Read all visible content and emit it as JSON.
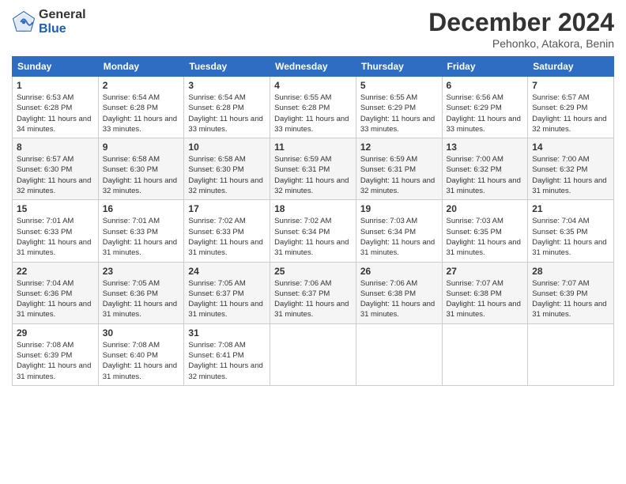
{
  "header": {
    "logo_general": "General",
    "logo_blue": "Blue",
    "month_year": "December 2024",
    "location": "Pehonko, Atakora, Benin"
  },
  "days_of_week": [
    "Sunday",
    "Monday",
    "Tuesday",
    "Wednesday",
    "Thursday",
    "Friday",
    "Saturday"
  ],
  "weeks": [
    [
      {
        "day": 1,
        "sunrise": "6:53 AM",
        "sunset": "6:28 PM",
        "daylight": "11 hours and 34 minutes."
      },
      {
        "day": 2,
        "sunrise": "6:54 AM",
        "sunset": "6:28 PM",
        "daylight": "11 hours and 33 minutes."
      },
      {
        "day": 3,
        "sunrise": "6:54 AM",
        "sunset": "6:28 PM",
        "daylight": "11 hours and 33 minutes."
      },
      {
        "day": 4,
        "sunrise": "6:55 AM",
        "sunset": "6:28 PM",
        "daylight": "11 hours and 33 minutes."
      },
      {
        "day": 5,
        "sunrise": "6:55 AM",
        "sunset": "6:29 PM",
        "daylight": "11 hours and 33 minutes."
      },
      {
        "day": 6,
        "sunrise": "6:56 AM",
        "sunset": "6:29 PM",
        "daylight": "11 hours and 33 minutes."
      },
      {
        "day": 7,
        "sunrise": "6:57 AM",
        "sunset": "6:29 PM",
        "daylight": "11 hours and 32 minutes."
      }
    ],
    [
      {
        "day": 8,
        "sunrise": "6:57 AM",
        "sunset": "6:30 PM",
        "daylight": "11 hours and 32 minutes."
      },
      {
        "day": 9,
        "sunrise": "6:58 AM",
        "sunset": "6:30 PM",
        "daylight": "11 hours and 32 minutes."
      },
      {
        "day": 10,
        "sunrise": "6:58 AM",
        "sunset": "6:30 PM",
        "daylight": "11 hours and 32 minutes."
      },
      {
        "day": 11,
        "sunrise": "6:59 AM",
        "sunset": "6:31 PM",
        "daylight": "11 hours and 32 minutes."
      },
      {
        "day": 12,
        "sunrise": "6:59 AM",
        "sunset": "6:31 PM",
        "daylight": "11 hours and 32 minutes."
      },
      {
        "day": 13,
        "sunrise": "7:00 AM",
        "sunset": "6:32 PM",
        "daylight": "11 hours and 31 minutes."
      },
      {
        "day": 14,
        "sunrise": "7:00 AM",
        "sunset": "6:32 PM",
        "daylight": "11 hours and 31 minutes."
      }
    ],
    [
      {
        "day": 15,
        "sunrise": "7:01 AM",
        "sunset": "6:33 PM",
        "daylight": "11 hours and 31 minutes."
      },
      {
        "day": 16,
        "sunrise": "7:01 AM",
        "sunset": "6:33 PM",
        "daylight": "11 hours and 31 minutes."
      },
      {
        "day": 17,
        "sunrise": "7:02 AM",
        "sunset": "6:33 PM",
        "daylight": "11 hours and 31 minutes."
      },
      {
        "day": 18,
        "sunrise": "7:02 AM",
        "sunset": "6:34 PM",
        "daylight": "11 hours and 31 minutes."
      },
      {
        "day": 19,
        "sunrise": "7:03 AM",
        "sunset": "6:34 PM",
        "daylight": "11 hours and 31 minutes."
      },
      {
        "day": 20,
        "sunrise": "7:03 AM",
        "sunset": "6:35 PM",
        "daylight": "11 hours and 31 minutes."
      },
      {
        "day": 21,
        "sunrise": "7:04 AM",
        "sunset": "6:35 PM",
        "daylight": "11 hours and 31 minutes."
      }
    ],
    [
      {
        "day": 22,
        "sunrise": "7:04 AM",
        "sunset": "6:36 PM",
        "daylight": "11 hours and 31 minutes."
      },
      {
        "day": 23,
        "sunrise": "7:05 AM",
        "sunset": "6:36 PM",
        "daylight": "11 hours and 31 minutes."
      },
      {
        "day": 24,
        "sunrise": "7:05 AM",
        "sunset": "6:37 PM",
        "daylight": "11 hours and 31 minutes."
      },
      {
        "day": 25,
        "sunrise": "7:06 AM",
        "sunset": "6:37 PM",
        "daylight": "11 hours and 31 minutes."
      },
      {
        "day": 26,
        "sunrise": "7:06 AM",
        "sunset": "6:38 PM",
        "daylight": "11 hours and 31 minutes."
      },
      {
        "day": 27,
        "sunrise": "7:07 AM",
        "sunset": "6:38 PM",
        "daylight": "11 hours and 31 minutes."
      },
      {
        "day": 28,
        "sunrise": "7:07 AM",
        "sunset": "6:39 PM",
        "daylight": "11 hours and 31 minutes."
      }
    ],
    [
      {
        "day": 29,
        "sunrise": "7:08 AM",
        "sunset": "6:39 PM",
        "daylight": "11 hours and 31 minutes."
      },
      {
        "day": 30,
        "sunrise": "7:08 AM",
        "sunset": "6:40 PM",
        "daylight": "11 hours and 31 minutes."
      },
      {
        "day": 31,
        "sunrise": "7:08 AM",
        "sunset": "6:41 PM",
        "daylight": "11 hours and 32 minutes."
      },
      null,
      null,
      null,
      null
    ]
  ]
}
